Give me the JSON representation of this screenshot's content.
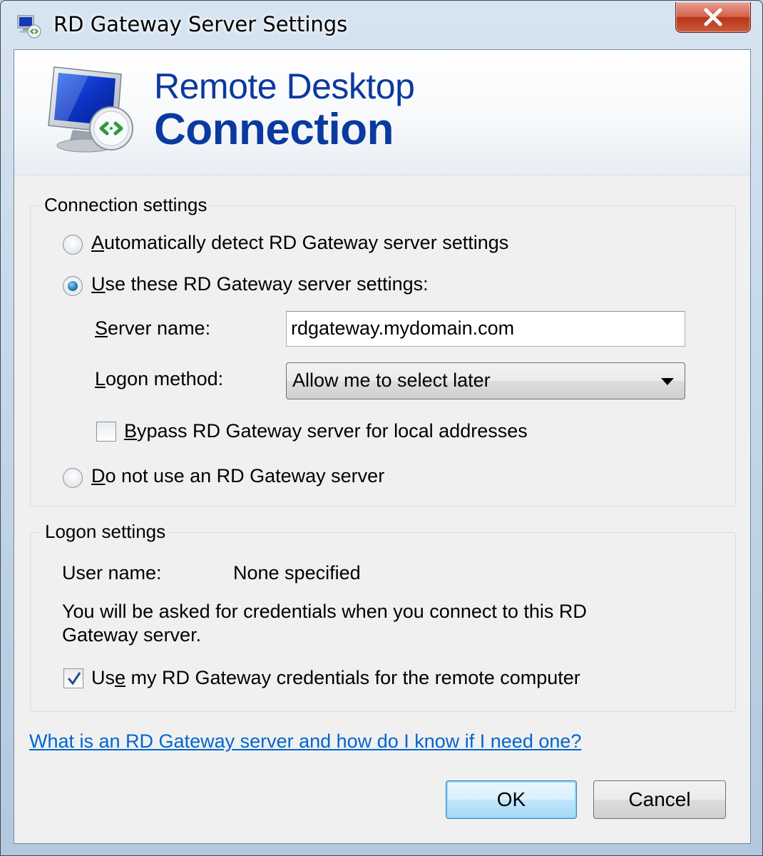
{
  "window": {
    "title": "RD Gateway Server Settings",
    "close_label": "×"
  },
  "banner": {
    "line1": "Remote Desktop",
    "line2": "Connection"
  },
  "connection_settings": {
    "legend": "Connection settings",
    "auto_detect": {
      "mnemonic": "A",
      "rest": "utomatically detect RD Gateway server settings",
      "checked": false
    },
    "use_these": {
      "mnemonic": "U",
      "rest": "se these RD Gateway server settings:",
      "checked": true
    },
    "server_name_label_mnemonic": "S",
    "server_name_label_rest": "erver name:",
    "server_name_value": "rdgateway.mydomain.com",
    "logon_method_label_mnemonic": "L",
    "logon_method_label_rest": "ogon method:",
    "logon_method_value": "Allow me to select later",
    "bypass": {
      "mnemonic": "B",
      "rest": "ypass RD Gateway server for local addresses",
      "checked": false
    },
    "do_not_use": {
      "mnemonic": "D",
      "rest": "o not use an RD Gateway server",
      "checked": false
    }
  },
  "logon_settings": {
    "legend": "Logon settings",
    "user_name_label": "User name:",
    "user_name_value": "None specified",
    "info_line1": "You will be asked for credentials when you connect to this RD",
    "info_line2": "Gateway server.",
    "use_credentials": {
      "before": "Us",
      "mnemonic": "e",
      "rest": " my RD Gateway credentials for the remote computer",
      "checked": true
    }
  },
  "help_link": "What is an RD Gateway server and how do I know if I need one?",
  "buttons": {
    "ok": "OK",
    "cancel": "Cancel"
  },
  "colors": {
    "banner_text": "#0a3a9e",
    "link": "#0066cc",
    "close_button": "#c8462b"
  }
}
